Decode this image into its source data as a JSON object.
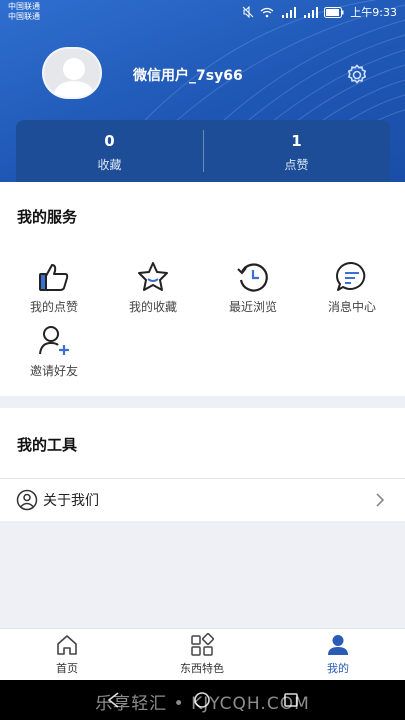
{
  "status_bar": {
    "carrier_1": "中国联通",
    "carrier_2": "中国联通",
    "time": "上午9:33"
  },
  "profile": {
    "username": "微信用户_7sy66"
  },
  "stats": [
    {
      "value": "0",
      "label": "收藏"
    },
    {
      "value": "1",
      "label": "点赞"
    }
  ],
  "services": {
    "title": "我的服务",
    "items": [
      {
        "label": "我的点赞",
        "icon": "thumbs-up-icon"
      },
      {
        "label": "我的收藏",
        "icon": "star-icon"
      },
      {
        "label": "最近浏览",
        "icon": "history-icon"
      },
      {
        "label": "消息中心",
        "icon": "message-icon"
      },
      {
        "label": "邀请好友",
        "icon": "add-user-icon"
      }
    ]
  },
  "tools": {
    "title": "我的工具",
    "about_label": "关于我们"
  },
  "bottom_nav": [
    {
      "label": "首页",
      "icon": "home-icon",
      "active": false
    },
    {
      "label": "东西特色",
      "icon": "grid-icon",
      "active": false
    },
    {
      "label": "我的",
      "icon": "user-icon",
      "active": true
    }
  ],
  "watermark": "乐享轻汇 • KJYCQH.COM",
  "colors": {
    "brand_blue": "#1f57b5",
    "active_nav": "#2a5bb5"
  }
}
